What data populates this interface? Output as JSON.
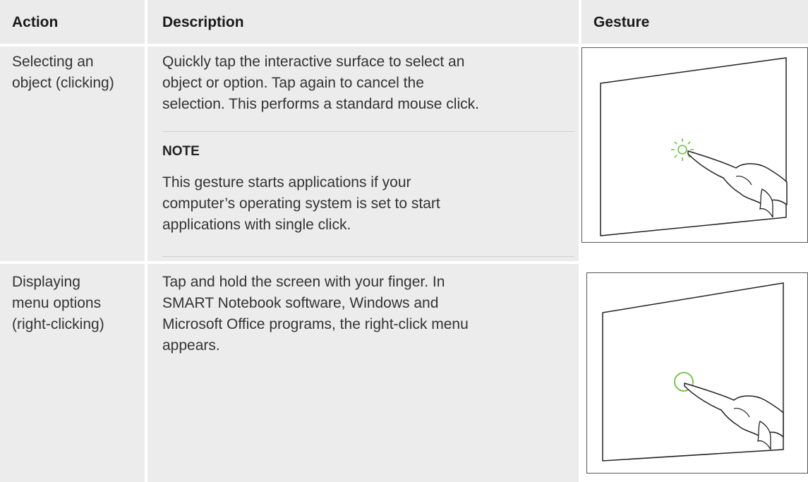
{
  "headers": {
    "action": "Action",
    "description": "Description",
    "gesture": "Gesture"
  },
  "rows": [
    {
      "action": [
        "Selecting an",
        "object (clicking)"
      ],
      "description": [
        "Quickly tap the interactive surface to select an",
        "object or option. Tap again to cancel the",
        "selection. This performs a standard mouse click."
      ],
      "note": {
        "title": "NOTE",
        "text": [
          "This gesture starts applications if your",
          "computer’s operating system is set to start",
          "applications with single click."
        ]
      },
      "gesture_icon": "tap-gesture-icon"
    },
    {
      "action": [
        "Displaying",
        "menu options",
        "(right-clicking)"
      ],
      "description": [
        "Tap and hold the screen with your finger. In",
        "SMART Notebook software, Windows and",
        "Microsoft Office programs, the right-click menu",
        "appears."
      ],
      "gesture_icon": "press-and-hold-gesture-icon"
    }
  ],
  "colors": {
    "header_bg": "#ebebeb",
    "cell_bg": "#ececec",
    "accent_green": "#6cc04a"
  }
}
